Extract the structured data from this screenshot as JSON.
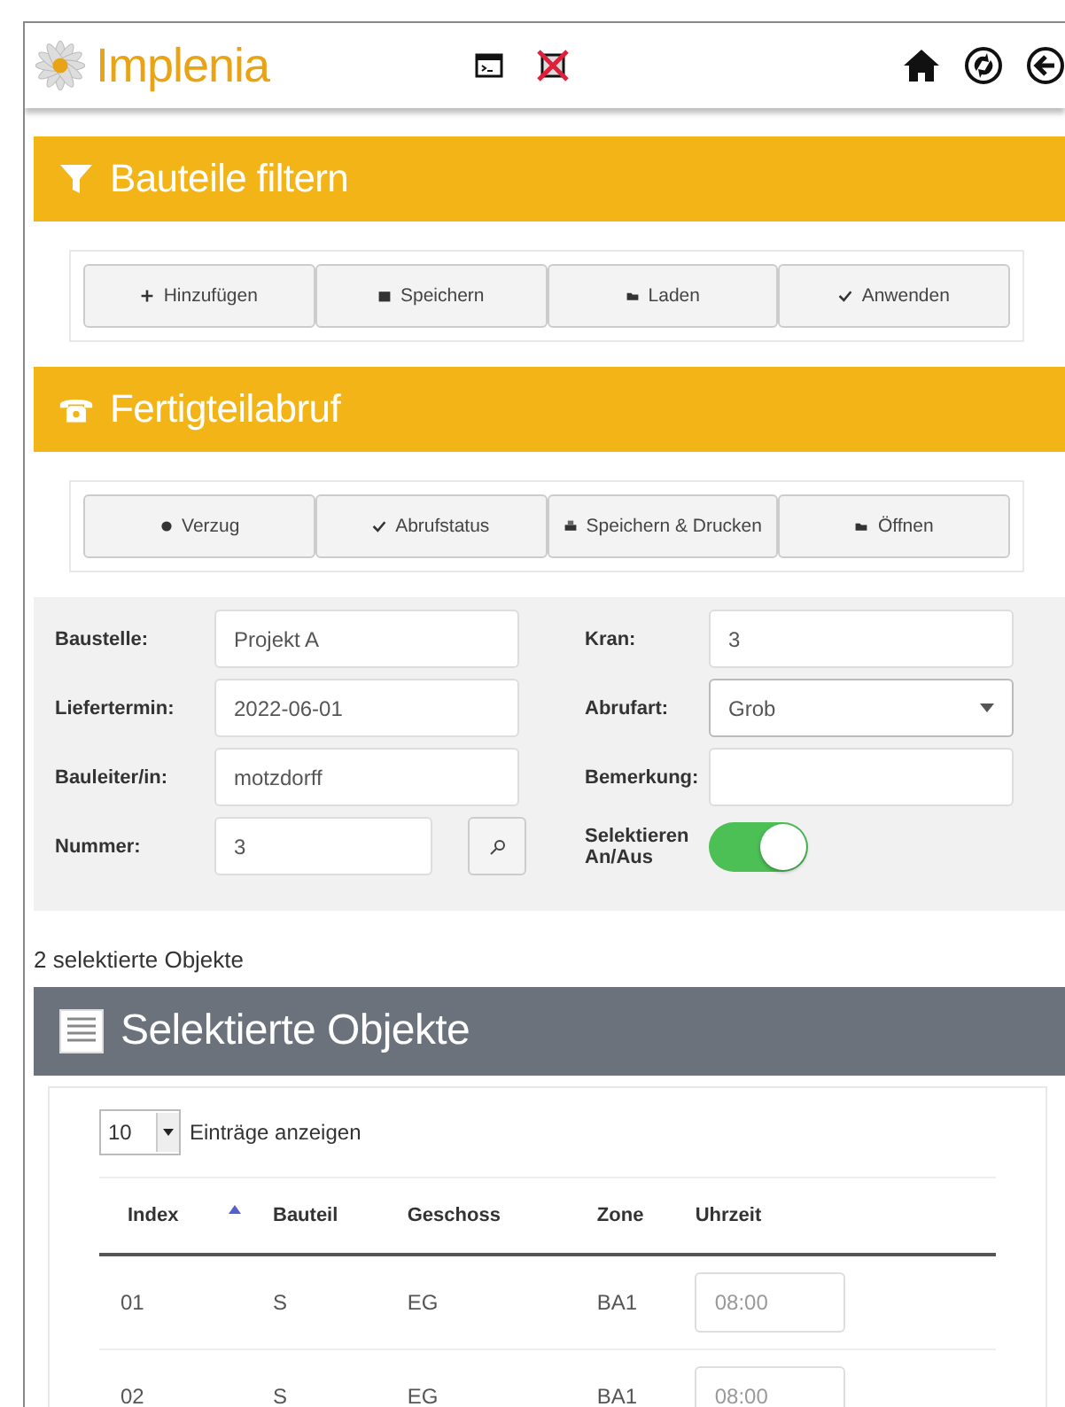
{
  "header": {
    "logo_text": "Implenia"
  },
  "filter_section": {
    "title": "Bauteile filtern",
    "buttons": [
      {
        "label": "Hinzufügen",
        "kind": "plus"
      },
      {
        "label": "Speichern",
        "kind": "save"
      },
      {
        "label": "Laden",
        "kind": "folder"
      },
      {
        "label": "Anwenden",
        "kind": "check"
      }
    ]
  },
  "callup_section": {
    "title": "Fertigteilabruf",
    "buttons": [
      {
        "label": "Verzug",
        "kind": "dot"
      },
      {
        "label": "Abrufstatus",
        "kind": "check"
      },
      {
        "label": "Speichern & Drucken",
        "kind": "print"
      },
      {
        "label": "Öffnen",
        "kind": "folder"
      }
    ]
  },
  "form": {
    "left": [
      {
        "label": "Baustelle:",
        "kind": "text",
        "value": "Projekt A"
      },
      {
        "label": "Liefertermin:",
        "kind": "text",
        "value": "2022-06-01"
      },
      {
        "label": "Bauleiter/in:",
        "kind": "text",
        "value": "motzdorff"
      },
      {
        "label": "Nummer:",
        "kind": "search",
        "value": "3"
      }
    ],
    "right": [
      {
        "label": "Kran:",
        "kind": "text",
        "value": "3"
      },
      {
        "label": "Abrufart:",
        "kind": "select",
        "value": "Grob"
      },
      {
        "label": "Bemerkung:",
        "kind": "textarea"
      },
      {
        "label": "Selektieren An/Aus",
        "kind": "toggle",
        "on": true
      }
    ]
  },
  "selection_count": "2 selektierte Objekte",
  "objects_section": {
    "title": "Selektierte Objekte",
    "page_size": "10",
    "page_size_label": "Einträge anzeigen",
    "table": {
      "columns": [
        {
          "label": "Index",
          "sorted": true
        },
        {
          "label": "Bauteil",
          "sorted": false
        },
        {
          "label": "Geschoss",
          "sorted": false
        },
        {
          "label": "Zone",
          "sorted": false
        },
        {
          "label": "Uhrzeit",
          "sorted": false
        }
      ],
      "rows": [
        {
          "index": "01",
          "bauteil": "S",
          "geschoss": "EG",
          "zone": "BA1",
          "uhrzeit_placeholder": "08:00"
        },
        {
          "index": "02",
          "bauteil": "S",
          "geschoss": "EG",
          "zone": "BA1",
          "uhrzeit_placeholder": "08:00"
        }
      ]
    }
  }
}
